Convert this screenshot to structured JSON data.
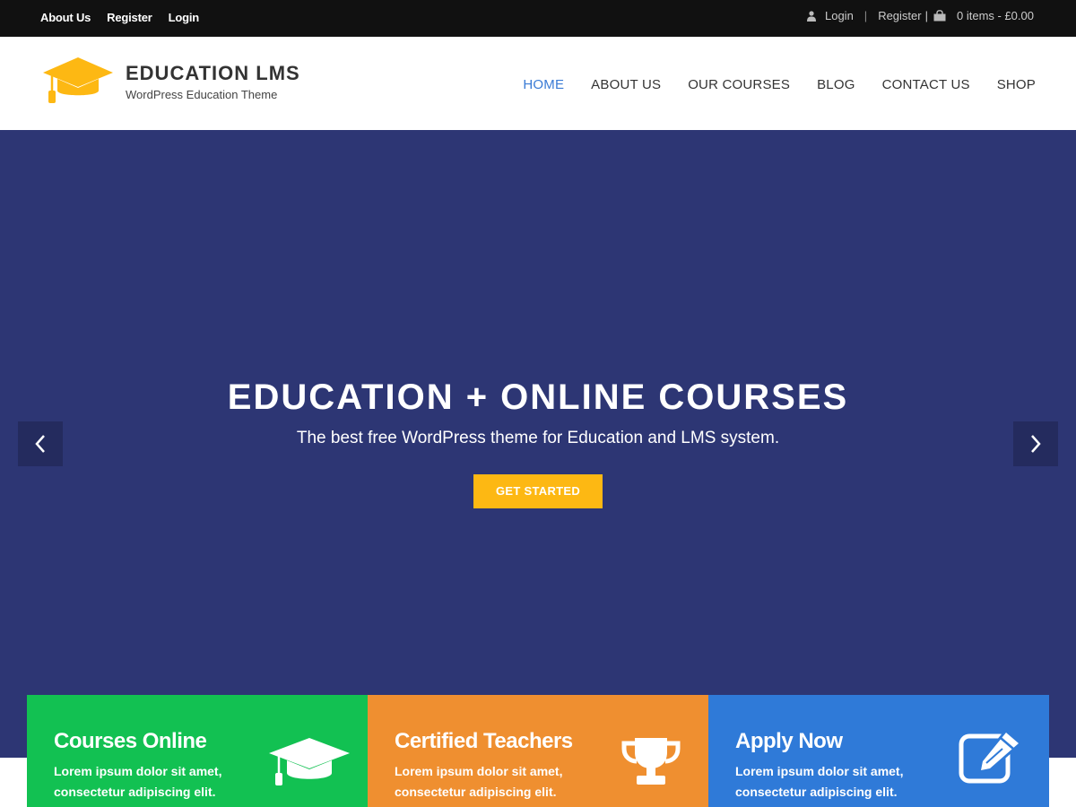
{
  "topbar": {
    "left_links": [
      "About Us",
      "Register",
      "Login"
    ],
    "login_label": "Login",
    "register_label": "Register",
    "cart_label": "0 items - £0.00"
  },
  "header": {
    "title": "EDUCATION LMS",
    "tagline": "WordPress Education Theme",
    "nav": [
      {
        "label": "HOME",
        "active": true
      },
      {
        "label": "ABOUT US",
        "active": false
      },
      {
        "label": "OUR COURSES",
        "active": false
      },
      {
        "label": "BLOG",
        "active": false
      },
      {
        "label": "CONTACT US",
        "active": false
      },
      {
        "label": "SHOP",
        "active": false
      }
    ]
  },
  "hero": {
    "title": "EDUCATION + ONLINE COURSES",
    "subtitle": "The best free WordPress theme for Education and LMS system.",
    "button_label": "GET STARTED",
    "prev_icon": "chevron-left-icon",
    "next_icon": "chevron-right-icon"
  },
  "features": [
    {
      "title": "Courses Online",
      "text": "Lorem ipsum dolor sit amet, consectetur adipiscing elit.",
      "icon": "graduation-cap-icon",
      "color": "#12c152"
    },
    {
      "title": "Certified Teachers",
      "text": "Lorem ipsum dolor sit amet, consectetur adipiscing elit.",
      "icon": "trophy-icon",
      "color": "#ef8f30"
    },
    {
      "title": "Apply Now",
      "text": "Lorem ipsum dolor sit amet, consectetur adipiscing elit.",
      "icon": "edit-icon",
      "color": "#2f7ad8"
    }
  ],
  "colors": {
    "topbar_bg": "#111111",
    "hero_bg": "#2d3674",
    "accent_yellow": "#fdb813",
    "nav_active": "#3a7bd5"
  }
}
